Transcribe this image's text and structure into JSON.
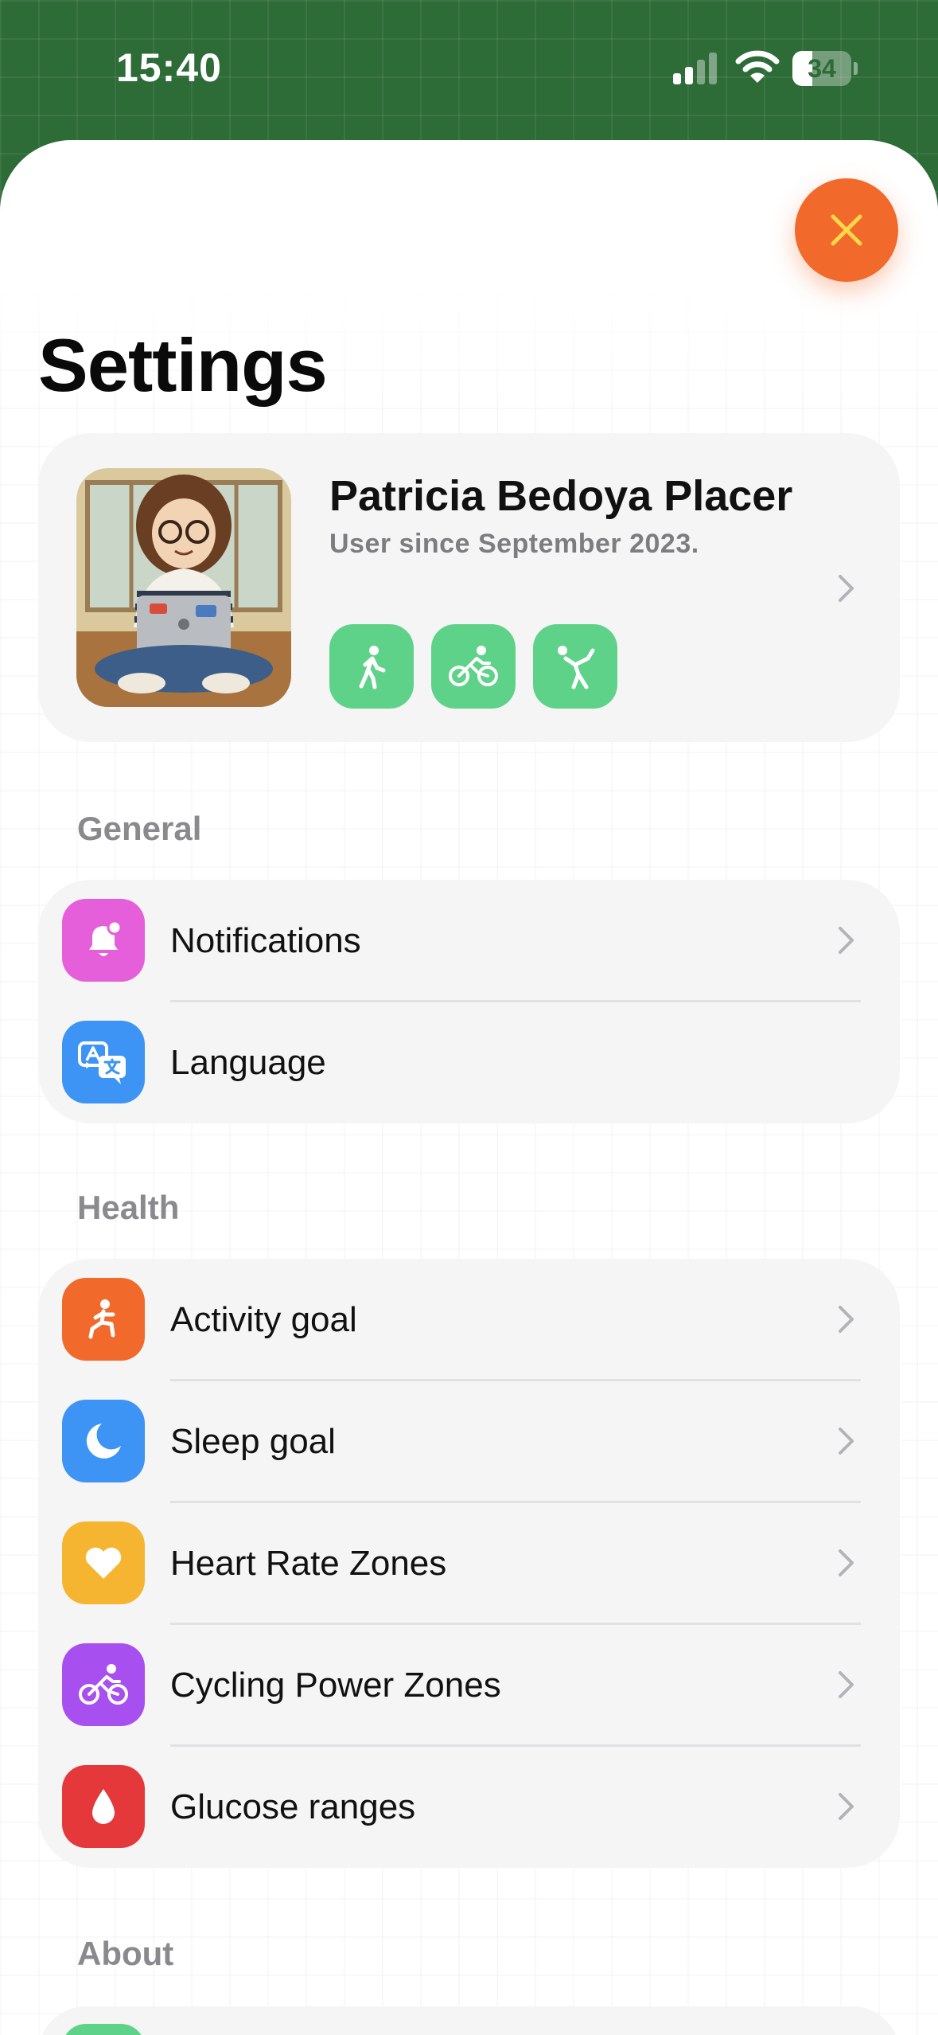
{
  "status_bar": {
    "time": "15:40",
    "battery": "34",
    "battery_level": 0.34
  },
  "header": {
    "title": "Settings"
  },
  "profile": {
    "name": "Patricia Bedoya Placer",
    "since": "User since September 2023.",
    "activities": [
      "walking-icon",
      "cycling-icon",
      "stretching-icon"
    ],
    "activity_color": "#5fd28a"
  },
  "sections": {
    "general": {
      "label": "General",
      "items": [
        {
          "label": "Notifications",
          "icon": "bell-icon",
          "color": "#e45fd9"
        },
        {
          "label": "Language",
          "icon": "translate-icon",
          "color": "#3d94f5"
        }
      ]
    },
    "health": {
      "label": "Health",
      "items": [
        {
          "label": "Activity goal",
          "icon": "lunge-icon",
          "color": "#f2692c"
        },
        {
          "label": "Sleep goal",
          "icon": "moon-icon",
          "color": "#3d94f5"
        },
        {
          "label": "Heart Rate Zones",
          "icon": "heart-icon",
          "color": "#f5b531"
        },
        {
          "label": "Cycling Power Zones",
          "icon": "bicycle-icon",
          "color": "#a84ff0"
        },
        {
          "label": "Glucose ranges",
          "icon": "drop-icon",
          "color": "#e5383b"
        }
      ]
    },
    "about": {
      "label": "About"
    }
  },
  "colors": {
    "accent": "#f2692c",
    "close_icon": "#ffd74a",
    "card_bg": "#f5f5f6"
  }
}
